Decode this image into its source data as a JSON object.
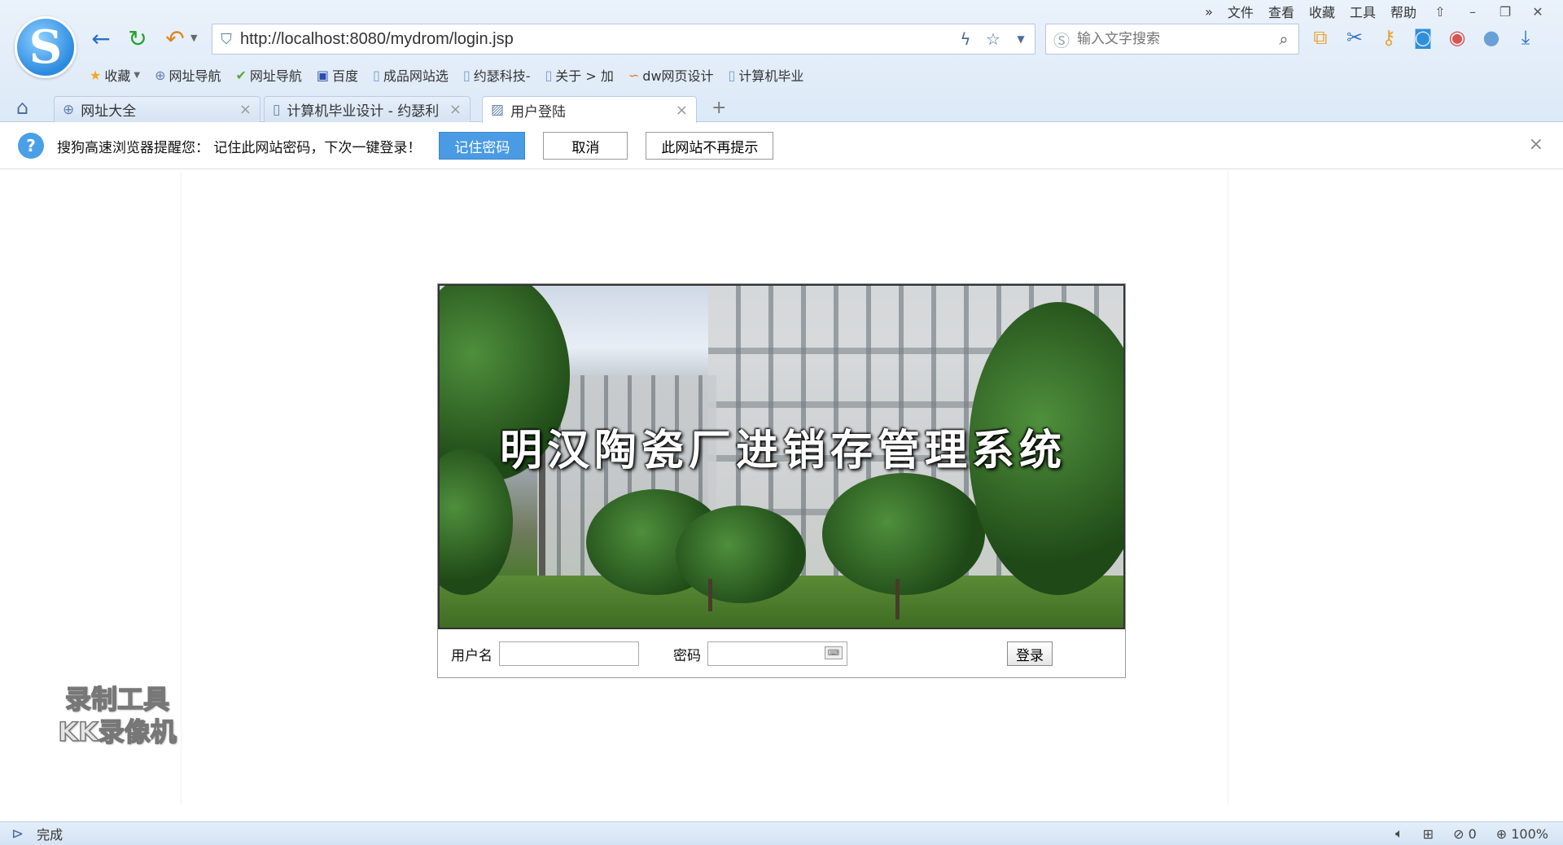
{
  "menu": {
    "more": "»",
    "items": [
      "文件",
      "查看",
      "收藏",
      "工具",
      "帮助"
    ],
    "window": {
      "skin": "⇧",
      "minimize": "–",
      "restore": "❐",
      "close": "✕"
    }
  },
  "nav": {
    "back": "←",
    "refresh": "↻",
    "undo": "↶"
  },
  "address": {
    "url": "http://localhost:8080/mydrom/login.jsp"
  },
  "search": {
    "placeholder": "输入文字搜索"
  },
  "bookmarks": [
    {
      "label": "收藏",
      "icon": "star-icon"
    },
    {
      "label": "网址导航",
      "icon": "globe-icon"
    },
    {
      "label": "网址导航",
      "icon": "hao123-icon"
    },
    {
      "label": "百度",
      "icon": "baidu-icon"
    },
    {
      "label": "成品网站选",
      "icon": "page-icon"
    },
    {
      "label": "约瑟科技-",
      "icon": "page-icon"
    },
    {
      "label": "关于 > 加",
      "icon": "page-icon"
    },
    {
      "label": "dw网页设计",
      "icon": "dw-icon"
    },
    {
      "label": "计算机毕业",
      "icon": "page-icon"
    }
  ],
  "tabs": [
    {
      "label": "网址大全",
      "active": false
    },
    {
      "label": "计算机毕业设计 - 约瑟利",
      "active": false
    },
    {
      "label": "用户登陆",
      "active": true
    }
  ],
  "notify": {
    "message": "搜狗高速浏览器提醒您： 记住此网站密码，下次一键登录！",
    "remember": "记住密码",
    "cancel": "取消",
    "never": "此网站不再提示"
  },
  "login": {
    "title": "明汉陶瓷厂进销存管理系统",
    "username_label": "用户名",
    "username_value": "",
    "password_label": "密码",
    "password_value": "",
    "submit": "登录"
  },
  "watermark": {
    "line1": "录制工具",
    "line2": "KK录像机"
  },
  "status": {
    "text": "完成",
    "count": "0",
    "zoom": "100%"
  }
}
